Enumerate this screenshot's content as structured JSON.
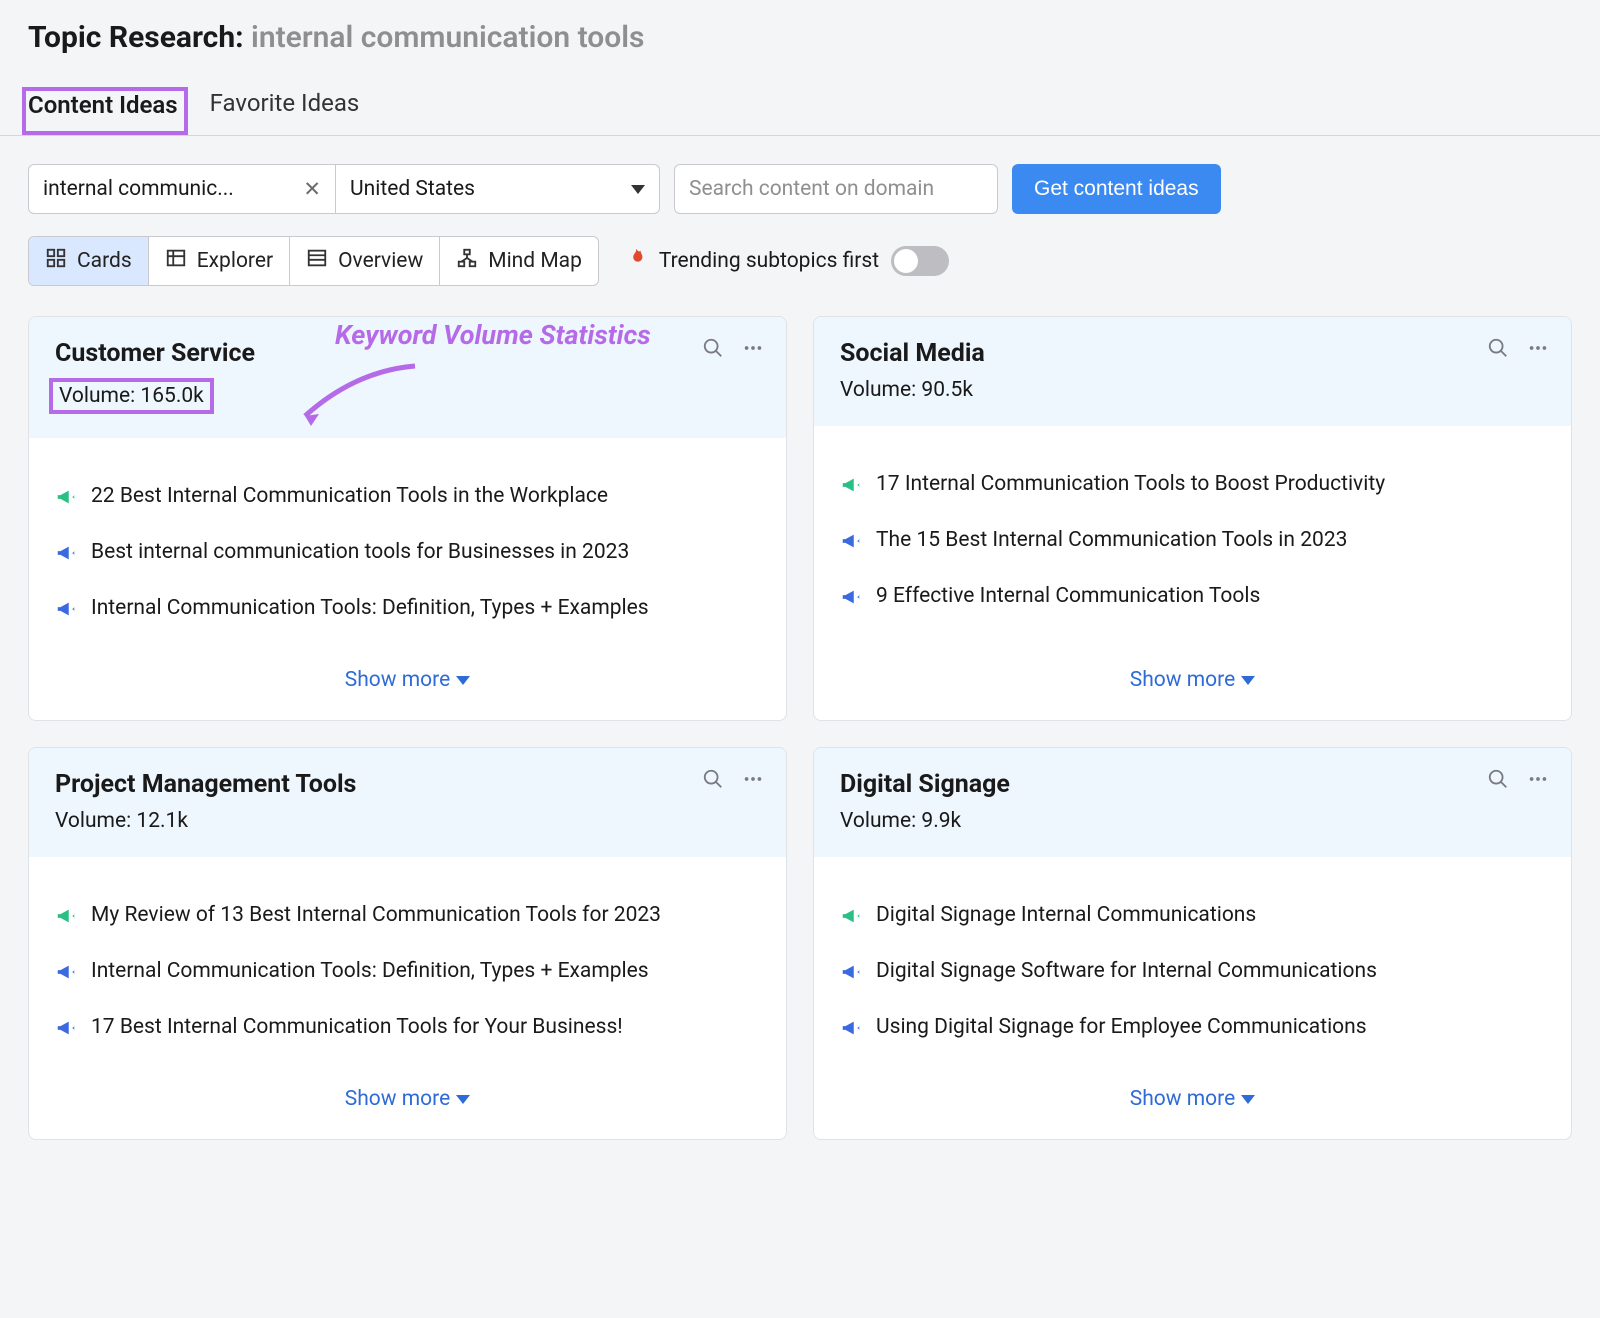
{
  "title_prefix": "Topic Research:",
  "title_topic": "internal communication tools",
  "tabs": {
    "content_ideas": "Content Ideas",
    "favorite_ideas": "Favorite Ideas"
  },
  "controls": {
    "keyword_value": "internal communic...",
    "country_value": "United States",
    "search_placeholder": "Search content on domain",
    "get_ideas_label": "Get content ideas"
  },
  "views": {
    "cards": "Cards",
    "explorer": "Explorer",
    "overview": "Overview",
    "mindmap": "Mind Map"
  },
  "trending_label": "Trending subtopics first",
  "annotation_label": "Keyword Volume Statistics",
  "show_more_label": "Show more",
  "cards": [
    {
      "title": "Customer Service",
      "volume_label": "Volume:",
      "volume_value": "165.0k",
      "ideas": [
        {
          "color": "green",
          "text": "22 Best Internal Communication Tools in the Workplace"
        },
        {
          "color": "blue",
          "text": "Best internal communication tools for Businesses in 2023"
        },
        {
          "color": "blue",
          "text": "Internal Communication Tools: Definition, Types + Examples"
        }
      ]
    },
    {
      "title": "Social Media",
      "volume_label": "Volume:",
      "volume_value": "90.5k",
      "ideas": [
        {
          "color": "green",
          "text": "17 Internal Communication Tools to Boost Productivity"
        },
        {
          "color": "blue",
          "text": "The 15 Best Internal Communication Tools in 2023"
        },
        {
          "color": "blue",
          "text": "9 Effective Internal Communication Tools"
        }
      ]
    },
    {
      "title": "Project Management Tools",
      "volume_label": "Volume:",
      "volume_value": "12.1k",
      "ideas": [
        {
          "color": "green",
          "text": "My Review of 13 Best Internal Communication Tools for 2023"
        },
        {
          "color": "blue",
          "text": "Internal Communication Tools: Definition, Types + Examples"
        },
        {
          "color": "blue",
          "text": "17 Best Internal Communication Tools for Your Business!"
        }
      ]
    },
    {
      "title": "Digital Signage",
      "volume_label": "Volume:",
      "volume_value": "9.9k",
      "ideas": [
        {
          "color": "green",
          "text": "Digital Signage Internal Communications"
        },
        {
          "color": "blue",
          "text": "Digital Signage Software for Internal Communications"
        },
        {
          "color": "blue",
          "text": "Using Digital Signage for Employee Communications"
        }
      ]
    }
  ]
}
